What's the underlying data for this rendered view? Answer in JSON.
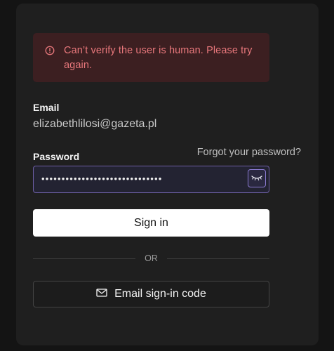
{
  "alert": {
    "message": "Can’t verify the user is human. Please try again.",
    "icon": "alert-circle-icon",
    "color": "#e9787c",
    "background": "#3c1f21"
  },
  "email": {
    "label": "Email",
    "value": "elizabethlilosi@gazeta.pl"
  },
  "password": {
    "label": "Password",
    "forgot_label": "Forgot your password?",
    "masked_value": "••••••••••••••••••••••••••••••",
    "toggle_icon": "eye-closed-icon",
    "focus_color": "#6d5fa6"
  },
  "actions": {
    "sign_in_label": "Sign in",
    "divider_label": "OR",
    "email_code_label": "Email sign-in code",
    "email_code_icon": "mail-icon"
  }
}
